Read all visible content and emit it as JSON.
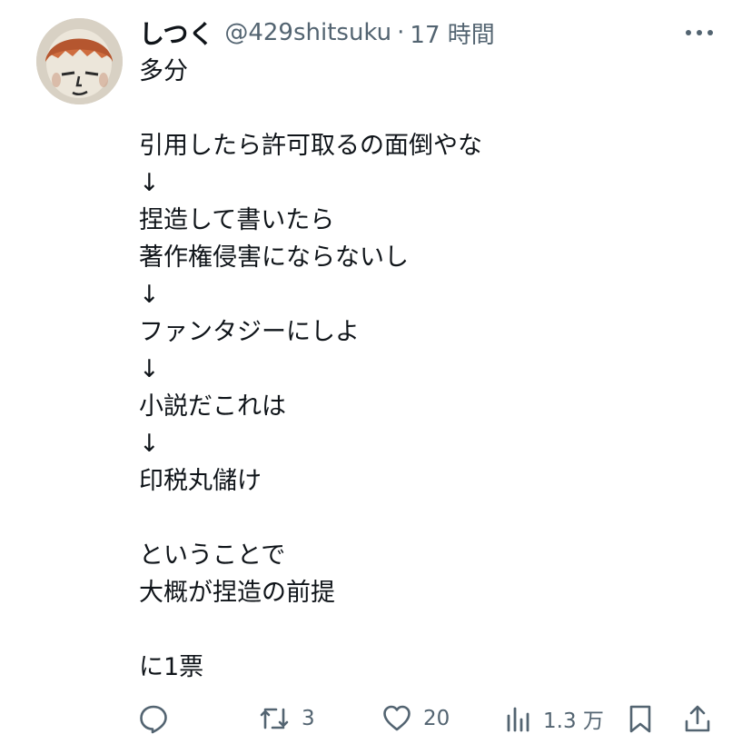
{
  "user": {
    "display_name": "しつく",
    "handle": "@429shitsuku",
    "separator": "·",
    "time": "17 時間"
  },
  "tweet": {
    "lines": [
      "多分",
      "",
      "引用したら許可取るの面倒やな",
      "↓",
      "捏造して書いたら",
      "著作権侵害にならないし",
      "↓",
      "ファンタジーにしよ",
      "↓",
      "小説だこれは",
      "↓",
      "印税丸儲け",
      "",
      "ということで",
      "大概が捏造の前提",
      "",
      "に1票"
    ]
  },
  "actions": {
    "reply_icon": "reply-icon",
    "retweet_icon": "retweet-icon",
    "retweet_count": "3",
    "like_icon": "heart-icon",
    "like_count": "20",
    "views_icon": "views-icon",
    "views_count": "1.3 万",
    "bookmark_icon": "bookmark-icon",
    "share_icon": "share-icon",
    "more_icon": "more-icon"
  },
  "colors": {
    "text": "#0f1419",
    "secondary": "#536471"
  }
}
